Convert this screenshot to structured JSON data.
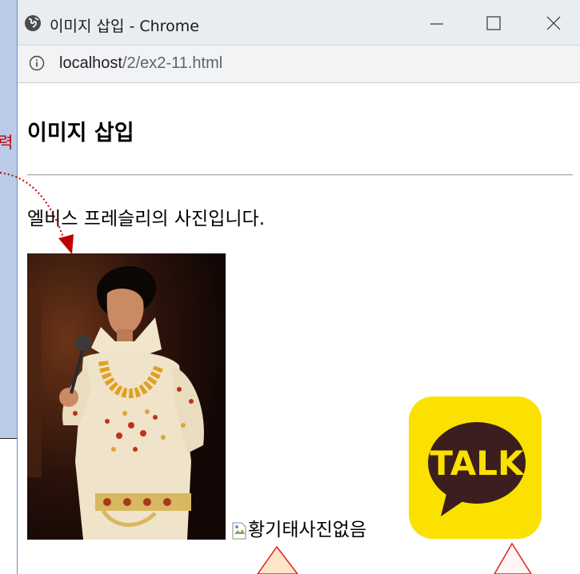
{
  "window": {
    "title": "이미지 삽입 - Chrome",
    "address_host": "localhost",
    "address_path": "/2/ex2-11.html"
  },
  "background_slide": {
    "red_text": "력"
  },
  "page": {
    "heading": "이미지 삽입",
    "paragraph": "엘비스 프레슬리의 사진입니다.",
    "broken_image_alt": "황기태사진없음",
    "kakao_logo_text": "TALK"
  },
  "colors": {
    "titlebar_bg": "#e9ecf1",
    "kakao_yellow": "#fae100",
    "kakao_brown": "#3c1e1e",
    "annotation_red": "#c00000"
  }
}
